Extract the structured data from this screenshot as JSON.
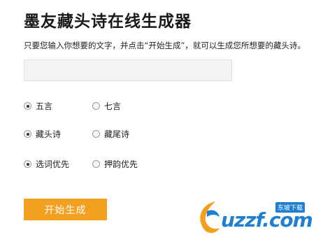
{
  "page": {
    "title": "墨友藏头诗在线生成器",
    "description": "只要您输入你想要的文字，并点击“开始生成”，就可以生成您所想要的藏头诗。"
  },
  "input": {
    "value": ""
  },
  "options": {
    "length": {
      "left": "五言",
      "right": "七言",
      "selected": "五言"
    },
    "position": {
      "left": "藏头诗",
      "right": "藏尾诗",
      "selected": "藏头诗"
    },
    "mode": {
      "left": "选词优先",
      "right": "押韵优先",
      "selected": "选词优先"
    }
  },
  "button": {
    "label": "开始生成"
  },
  "watermark": {
    "text": "uzzf.com",
    "badge": "东坡下载"
  },
  "colors": {
    "button": "#f3a020",
    "watermark": "#1f7fd0"
  }
}
